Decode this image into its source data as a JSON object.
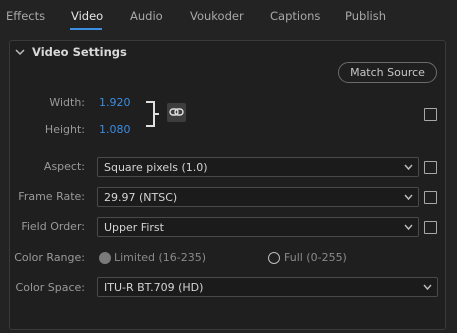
{
  "tabs": [
    {
      "label": "Effects"
    },
    {
      "label": "Video"
    },
    {
      "label": "Audio"
    },
    {
      "label": "Voukoder"
    },
    {
      "label": "Captions"
    },
    {
      "label": "Publish"
    }
  ],
  "active_tab": "Video",
  "section": {
    "title": "Video Settings"
  },
  "match_source_label": "Match Source",
  "width": {
    "label": "Width:",
    "value": "1.920"
  },
  "height": {
    "label": "Height:",
    "value": "1.080"
  },
  "aspect": {
    "label": "Aspect:",
    "value": "Square pixels (1.0)"
  },
  "frame_rate": {
    "label": "Frame Rate:",
    "value": "29.97 (NTSC)"
  },
  "field_order": {
    "label": "Field Order:",
    "value": "Upper First"
  },
  "color_range": {
    "label": "Color Range:",
    "options": [
      {
        "label": "Limited (16-235)",
        "selected": true
      },
      {
        "label": "Full (0-255)",
        "selected": false
      }
    ]
  },
  "color_space": {
    "label": "Color Space:",
    "value": "ITU-R BT.709 (HD)"
  },
  "colors": {
    "accent": "#3b8de0",
    "background": "#232323",
    "panel": "#1f1f1f"
  },
  "icons": {
    "link": "link-icon",
    "chevron": "chevron-down-icon",
    "caret": "dropdown-caret-icon"
  }
}
